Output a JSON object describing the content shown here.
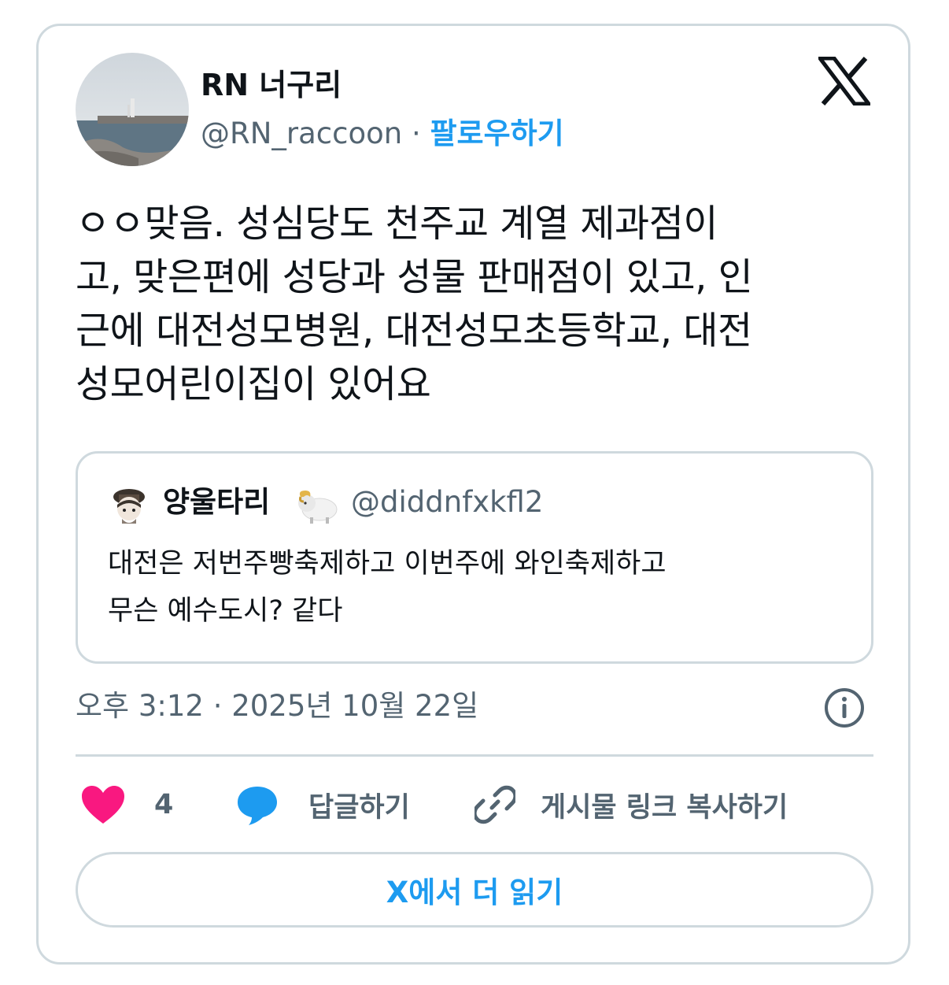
{
  "tweet": {
    "author": {
      "display_name": "RN 너구리",
      "handle": "@RN_raccoon",
      "separator": "·",
      "follow_label": "팔로우하기"
    },
    "text": "ㅇㅇ맞음. 성심당도 천주교 계열 제과점이\n고, 맞은편에 성당과 성물 판매점이 있고, 인\n근에 대전성모병원, 대전성모초등학교, 대전\n성모어린이집이 있어요",
    "quoted": {
      "display_name": "양울타리",
      "handle": "@diddnfxkfl2",
      "text": "대전은 저번주빵축제하고 이번주에 와인축제하고\n무슨 예수도시? 같다"
    },
    "timestamp": "오후 3:12 · 2025년 10월 22일",
    "actions": {
      "like_count": "4",
      "reply_label": "답글하기",
      "copy_link_label": "게시물 링크 복사하기"
    },
    "read_more_label": "X에서 더 읽기"
  },
  "icons": {
    "logo": "x-logo-icon",
    "info": "info-icon",
    "like": "heart-icon",
    "reply": "speech-bubble-icon",
    "copy": "link-icon",
    "quoted_badge": "sheep-emoji-icon"
  },
  "colors": {
    "accent": "#1d9bf0",
    "heart": "#f91880",
    "reply_bubble": "#1d9bf0",
    "secondary_text": "#536471",
    "border": "#cfd9de"
  }
}
